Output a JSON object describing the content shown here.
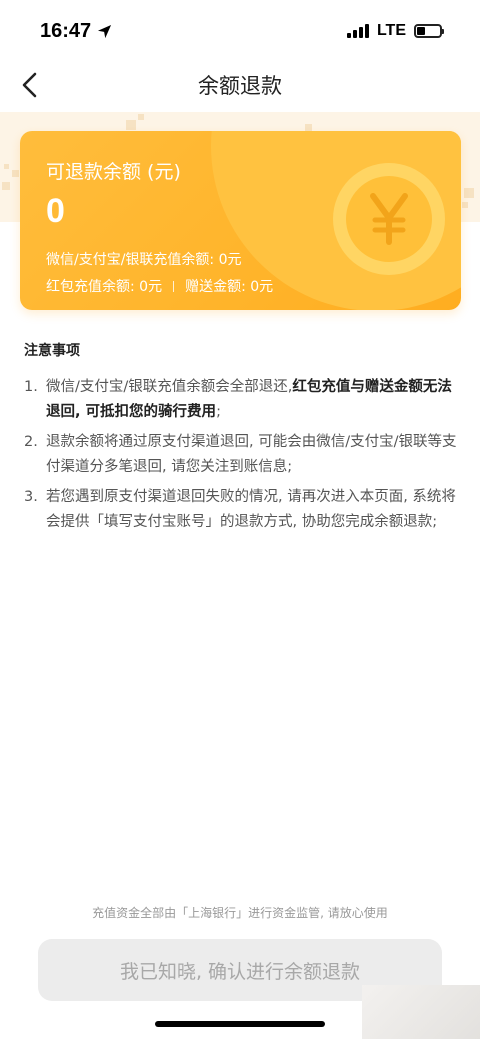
{
  "status_bar": {
    "time": "16:47",
    "network": "LTE",
    "battery_level": 0.35
  },
  "nav": {
    "title": "余额退款"
  },
  "card": {
    "label": "可退款余额 (元)",
    "amount": "0",
    "wechat_alipay_unionpay_label": "微信/支付宝/银联充值余额: 0元",
    "redpacket_label": "红包充值余额: 0元",
    "gift_label": "赠送金额: 0元",
    "coin_symbol": "¥"
  },
  "notes": {
    "title": "注意事项",
    "items": [
      {
        "num": "1.",
        "text_normal": "微信/支付宝/银联充值余额会全部退还,",
        "text_bold": "红包充值与赠送金额无法退回, 可抵扣您的骑行费用",
        "text_tail": ";"
      },
      {
        "num": "2.",
        "text_normal": "退款余额将通过原支付渠道退回, 可能会由微信/支付宝/银联等支付渠道分多笔退回, 请您关注到账信息;",
        "text_bold": "",
        "text_tail": ""
      },
      {
        "num": "3.",
        "text_normal": "若您遇到原支付渠道退回失败的情况, 请再次进入本页面, 系统将会提供「填写支付宝账号」的退款方式, 协助您完成余额退款;",
        "text_bold": "",
        "text_tail": ""
      }
    ]
  },
  "footer": {
    "note": "充值资金全部由「上海银行」进行资金监管, 请放心使用",
    "confirm_button": "我已知晓, 确认进行余额退款"
  },
  "colors": {
    "card_gradient_start": "#ffbd3c",
    "card_gradient_end": "#ffad20",
    "button_disabled_bg": "#ececec",
    "button_disabled_text": "#a8a8a8"
  }
}
